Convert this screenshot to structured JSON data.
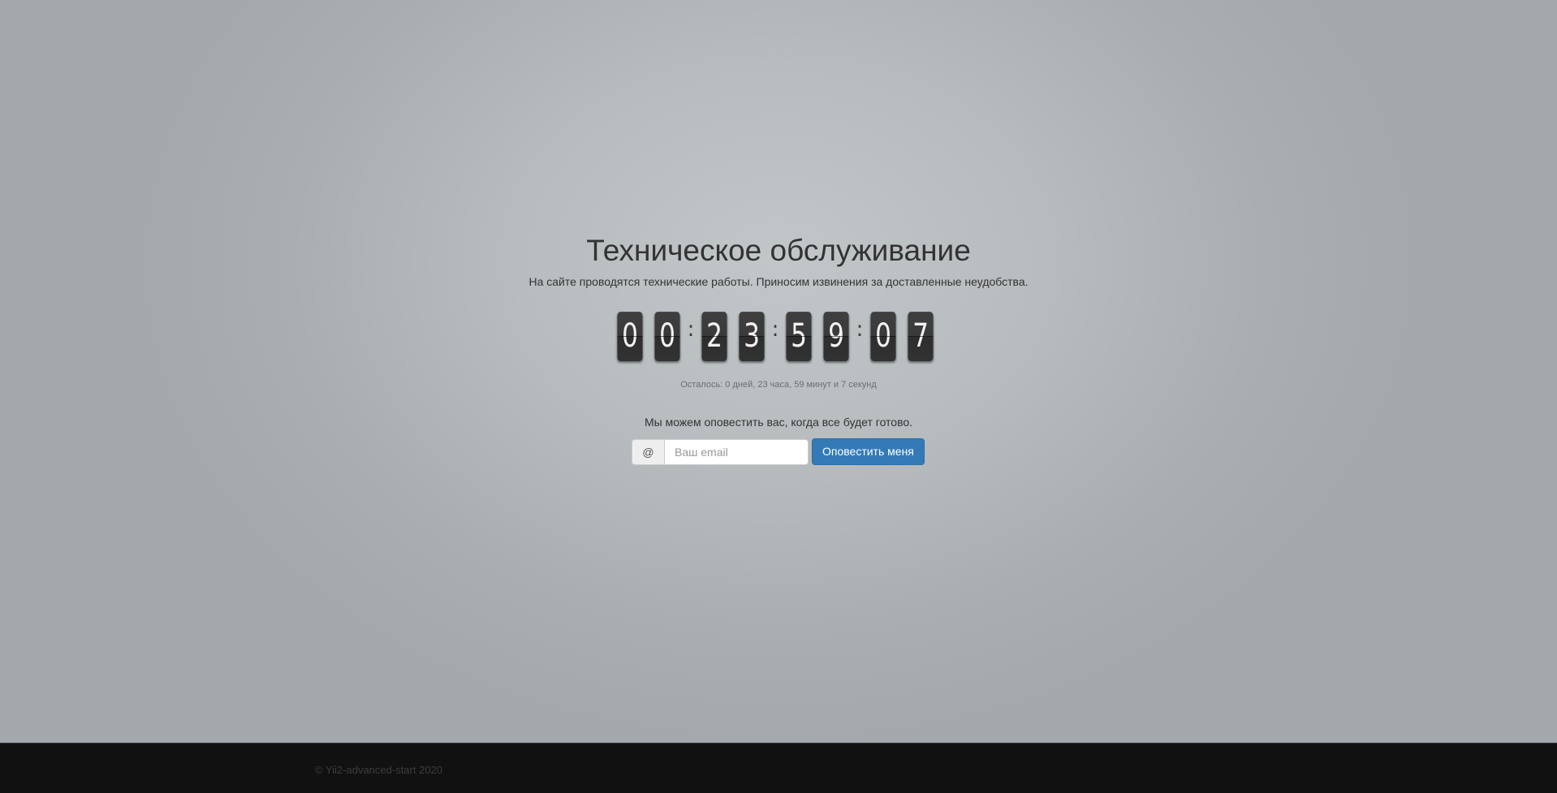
{
  "maintenance": {
    "title": "Техническое обслуживание",
    "subtitle": "На сайте проводятся технические работы. Приносим извинения за доставленные неудобства."
  },
  "countdown": {
    "digits": [
      "0",
      "0",
      "2",
      "3",
      "5",
      "9",
      "0",
      "7"
    ],
    "separator": ":",
    "remaining_text": "Осталось: 0 дней, 23 часа, 59 минут и 7 секунд"
  },
  "notify": {
    "text": "Мы можем оповестить вас, когда все будет готово.",
    "addon": "@",
    "email_placeholder": "Ваш email",
    "email_value": "",
    "button_label": "Оповестить меня",
    "button_color": "#337ab7"
  },
  "footer": {
    "copyright": "© Yii2-advanced-start 2020",
    "background": "#111111"
  }
}
